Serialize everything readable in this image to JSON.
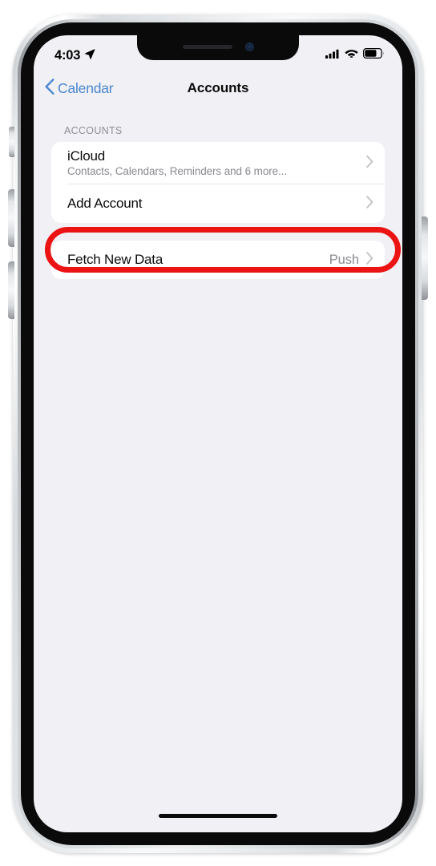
{
  "device": {
    "name": "iphone-x-silver",
    "frame_color": "#dfe2e5",
    "bezel_color": "#0a0a0a",
    "buttons": [
      {
        "name": "mute-switch"
      },
      {
        "name": "volume-up-button"
      },
      {
        "name": "volume-down-button"
      },
      {
        "name": "power-button"
      }
    ]
  },
  "status_bar": {
    "time": "4:03",
    "location_icon": "location-arrow-icon",
    "cellular_icon": "cellular-signal-icon",
    "cellular_bars": 4,
    "wifi_icon": "wifi-icon",
    "battery_icon": "battery-icon",
    "battery_level_pct": 68
  },
  "nav_bar": {
    "back_icon": "chevron-left-icon",
    "back_label": "Calendar",
    "title": "Accounts",
    "tint_color": "#4a86ce"
  },
  "content": {
    "section_header": "ACCOUNTS",
    "accounts_card": {
      "rows": [
        {
          "name": "icloud",
          "title": "iCloud",
          "subtitle": "Contacts, Calendars, Reminders and 6 more...",
          "chevron": "chevron-right-icon"
        },
        {
          "name": "add-account",
          "title": "Add Account",
          "subtitle": "",
          "chevron": "chevron-right-icon"
        }
      ]
    },
    "fetch_card": {
      "rows": [
        {
          "name": "fetch-new-data",
          "title": "Fetch New Data",
          "value": "Push",
          "chevron": "chevron-right-icon"
        }
      ]
    }
  },
  "annotation": {
    "type": "highlight-oval",
    "target": "add-account",
    "color": "#ec1313",
    "stroke_width_px": 7
  },
  "home_indicator": {
    "name": "home-indicator"
  }
}
